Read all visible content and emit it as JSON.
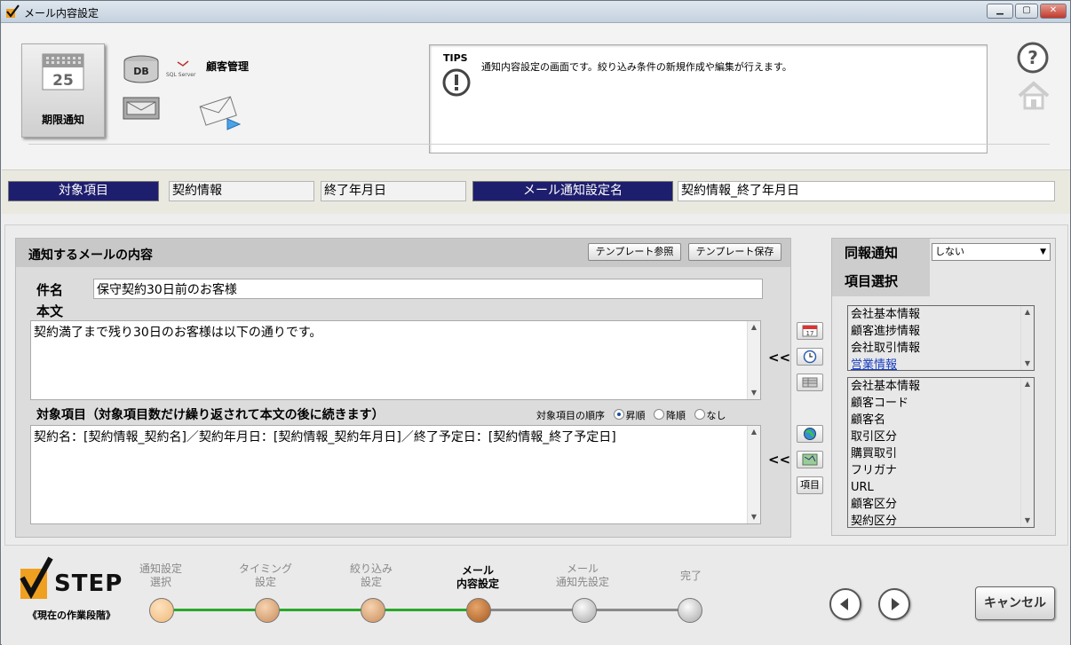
{
  "window": {
    "title": "メール内容設定",
    "minimize": "▁",
    "maximize": "▢",
    "close": "✕"
  },
  "header": {
    "tile_label": "期限通知",
    "calendar_day": "25",
    "db_label": "DB",
    "sql_label": "SQL Server",
    "system_label": "顧客管理",
    "tips_label": "TIPS",
    "tips_text": "通知内容設定の画面です。絞り込み条件の新規作成や編集が行えます。"
  },
  "infobar": {
    "target_label": "対象項目",
    "target_value1": "契約情報",
    "target_value2": "終了年月日",
    "setting_label": "メール通知設定名",
    "setting_value": "契約情報_終了年月日"
  },
  "mail": {
    "title": "通知するメールの内容",
    "template_ref": "テンプレート参照",
    "template_save": "テンプレート保存",
    "subject_label": "件名",
    "subject_value": "保守契約30日前のお客様",
    "body_label": "本文",
    "body_value": "契約満了まで残り30日のお客様は以下の通りです。",
    "items_label": "対象項目（対象項目数だけ繰り返されて本文の後に続きます）",
    "order_label": "対象項目の順序",
    "order_options": [
      "昇順",
      "降順",
      "なし"
    ],
    "order_selected": "昇順",
    "items_value": "契約名：[契約情報_契約名]／契約年月日：[契約情報_契約年月日]／終了予定日：[契約情報_終了予定日]",
    "insert_arrow": "<<",
    "item_button": "項目",
    "calendar_day_small": "17"
  },
  "right": {
    "cc_label": "同報通知",
    "cc_value": "しない",
    "select_label": "項目選択",
    "categories": [
      "会社基本情報",
      "顧客進捗情報",
      "会社取引情報",
      "営業情報"
    ],
    "selected_category": "営業情報",
    "fields": [
      "会社基本情報",
      "顧客コード",
      "顧客名",
      "取引区分",
      "購買取引",
      "フリガナ",
      "URL",
      "顧客区分",
      "契約区分"
    ]
  },
  "steps": {
    "logo_text": "STEP",
    "subtitle": "《現在の作業段階》",
    "items": [
      {
        "line1": "通知設定",
        "line2": "選択"
      },
      {
        "line1": "タイミング",
        "line2": "設定"
      },
      {
        "line1": "絞り込み",
        "line2": "設定"
      },
      {
        "line1": "メール",
        "line2": "内容設定"
      },
      {
        "line1": "メール",
        "line2": "通知先設定"
      },
      {
        "line1": "完了",
        "line2": ""
      }
    ],
    "current_index": 3,
    "cancel": "キャンセル"
  },
  "colors": {
    "navy": "#1e1e6e",
    "done_dot": "#f2c48e",
    "current_dot": "#c07a3a",
    "future_dot": "#d8d8d8",
    "track_done": "#2aa82a",
    "track_todo": "#8a8a8a"
  }
}
